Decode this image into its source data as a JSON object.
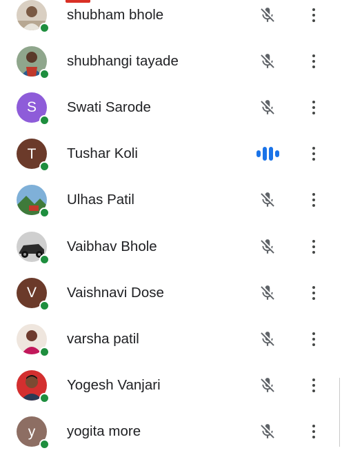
{
  "colors": {
    "online": "#1e8e3e",
    "speaking": "#1a73e8",
    "muted_icon": "#5f6368",
    "text": "#202124"
  },
  "participants": [
    {
      "name": "shubham bhole",
      "avatar": {
        "type": "photo",
        "icon": "person-photo"
      },
      "mic": "muted",
      "online": true
    },
    {
      "name": "shubhangi tayade",
      "avatar": {
        "type": "photo",
        "icon": "person-photo"
      },
      "mic": "muted",
      "online": true
    },
    {
      "name": "Swati Sarode",
      "avatar": {
        "type": "initial",
        "initial": "S",
        "color": "#8e5cd9"
      },
      "mic": "muted",
      "online": true
    },
    {
      "name": "Tushar Koli",
      "avatar": {
        "type": "initial",
        "initial": "T",
        "color": "#6b3a2a"
      },
      "mic": "speaking",
      "online": true
    },
    {
      "name": "Ulhas Patil",
      "avatar": {
        "type": "photo",
        "icon": "landscape-photo"
      },
      "mic": "muted",
      "online": true
    },
    {
      "name": "Vaibhav Bhole",
      "avatar": {
        "type": "photo",
        "icon": "vehicle-photo"
      },
      "mic": "muted",
      "online": true
    },
    {
      "name": "Vaishnavi Dose",
      "avatar": {
        "type": "initial",
        "initial": "V",
        "color": "#6b3a2a"
      },
      "mic": "muted",
      "online": true
    },
    {
      "name": "varsha patil",
      "avatar": {
        "type": "photo",
        "icon": "person-photo"
      },
      "mic": "muted",
      "online": true
    },
    {
      "name": "Yogesh Vanjari",
      "avatar": {
        "type": "photo",
        "icon": "person-photo"
      },
      "mic": "muted",
      "online": true
    },
    {
      "name": "yogita more",
      "avatar": {
        "type": "initial",
        "initial": "y",
        "color": "#8d6e63"
      },
      "mic": "muted",
      "online": true
    }
  ]
}
